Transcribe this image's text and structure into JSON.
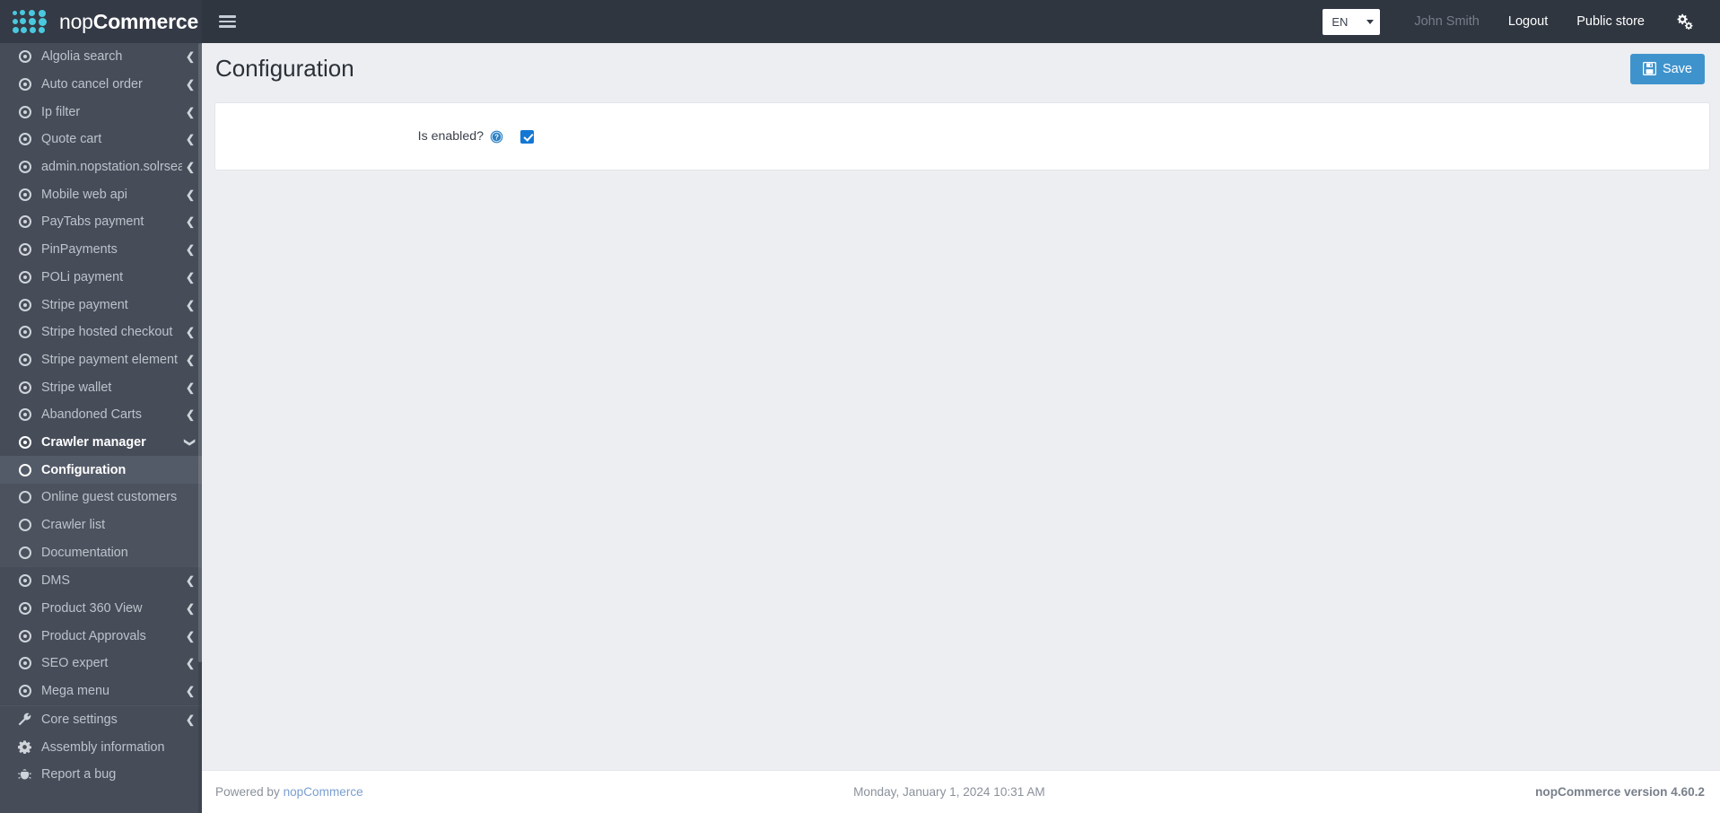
{
  "brand": {
    "name_light": "nop",
    "name_bold": "Commerce",
    "logo_icon": "nopcommerce-dots-logo"
  },
  "navbar": {
    "menu_toggle_icon": "hamburger-menu-icon",
    "language": {
      "selected": "EN",
      "options": [
        "EN"
      ],
      "caret_icon": "chevron-down-icon"
    },
    "user_name": "John Smith",
    "logout_label": "Logout",
    "public_store_label": "Public store",
    "settings_icon": "gears-icon",
    "background_color": "#2f3640"
  },
  "sidebar": {
    "scrollbar_visible": true,
    "items": [
      {
        "label": "Algolia search",
        "icon": "circle-dot-icon",
        "arrow": "chevron-left-icon",
        "state": "normal"
      },
      {
        "label": "Auto cancel order",
        "icon": "circle-dot-icon",
        "arrow": "chevron-left-icon",
        "state": "normal"
      },
      {
        "label": "Ip filter",
        "icon": "circle-dot-icon",
        "arrow": "chevron-left-icon",
        "state": "normal"
      },
      {
        "label": "Quote cart",
        "icon": "circle-dot-icon",
        "arrow": "chevron-left-icon",
        "state": "normal"
      },
      {
        "label": "admin.nopstation.solrsearch.",
        "icon": "circle-dot-icon",
        "arrow": "chevron-left-icon",
        "state": "normal"
      },
      {
        "label": "Mobile web api",
        "icon": "circle-dot-icon",
        "arrow": "chevron-left-icon",
        "state": "normal"
      },
      {
        "label": "PayTabs payment",
        "icon": "circle-dot-icon",
        "arrow": "chevron-left-icon",
        "state": "normal"
      },
      {
        "label": "PinPayments",
        "icon": "circle-dot-icon",
        "arrow": "chevron-left-icon",
        "state": "normal"
      },
      {
        "label": "POLi payment",
        "icon": "circle-dot-icon",
        "arrow": "chevron-left-icon",
        "state": "normal"
      },
      {
        "label": "Stripe payment",
        "icon": "circle-dot-icon",
        "arrow": "chevron-left-icon",
        "state": "normal"
      },
      {
        "label": "Stripe hosted checkout",
        "icon": "circle-dot-icon",
        "arrow": "chevron-left-icon",
        "state": "normal"
      },
      {
        "label": "Stripe payment element",
        "icon": "circle-dot-icon",
        "arrow": "chevron-left-icon",
        "state": "normal"
      },
      {
        "label": "Stripe wallet",
        "icon": "circle-dot-icon",
        "arrow": "chevron-left-icon",
        "state": "normal"
      },
      {
        "label": "Abandoned Carts",
        "icon": "circle-dot-icon",
        "arrow": "chevron-left-icon",
        "state": "normal"
      },
      {
        "label": "Crawler manager",
        "icon": "circle-dot-icon",
        "arrow": "chevron-down-icon",
        "state": "expanded"
      }
    ],
    "submenu": [
      {
        "label": "Configuration",
        "icon": "circle-outline-icon",
        "state": "current"
      },
      {
        "label": "Online guest customers",
        "icon": "circle-outline-icon",
        "state": "normal"
      },
      {
        "label": "Crawler list",
        "icon": "circle-outline-icon",
        "state": "normal"
      },
      {
        "label": "Documentation",
        "icon": "circle-outline-icon",
        "state": "normal"
      }
    ],
    "items_after": [
      {
        "label": "DMS",
        "icon": "circle-dot-icon",
        "arrow": "chevron-left-icon",
        "state": "normal"
      },
      {
        "label": "Product 360 View",
        "icon": "circle-dot-icon",
        "arrow": "chevron-left-icon",
        "state": "normal"
      },
      {
        "label": "Product Approvals",
        "icon": "circle-dot-icon",
        "arrow": "chevron-left-icon",
        "state": "normal"
      },
      {
        "label": "SEO expert",
        "icon": "circle-dot-icon",
        "arrow": "chevron-left-icon",
        "state": "normal"
      },
      {
        "label": "Mega menu",
        "icon": "circle-dot-icon",
        "arrow": "chevron-left-icon",
        "state": "normal"
      }
    ],
    "items_footer": [
      {
        "label": "Core settings",
        "icon": "wrench-icon",
        "arrow": "chevron-left-icon",
        "state": "normal"
      },
      {
        "label": "Assembly information",
        "icon": "gear-icon",
        "arrow": "",
        "state": "normal"
      },
      {
        "label": "Report a bug",
        "icon": "bug-icon",
        "arrow": "",
        "state": "normal"
      }
    ]
  },
  "main": {
    "page_title": "Configuration",
    "save_button": {
      "label": "Save",
      "icon": "save-floppy-icon",
      "color": "#3f93cd"
    },
    "form": {
      "is_enabled": {
        "label": "Is enabled?",
        "help_icon": "question-circle-help-icon",
        "checkbox_checked": true,
        "checkbox_color": "#1477d4"
      }
    }
  },
  "footer": {
    "powered_by_prefix": "Powered by ",
    "powered_by_link": "nopCommerce",
    "datetime": "Monday, January 1, 2024 10:31 AM",
    "version": "nopCommerce version 4.60.2"
  }
}
